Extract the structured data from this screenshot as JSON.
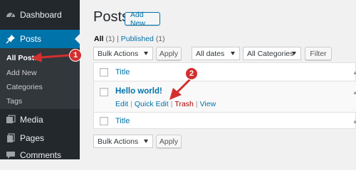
{
  "sidebar": {
    "dashboard": "Dashboard",
    "posts": "Posts",
    "submenu": [
      "All Posts",
      "Add New",
      "Categories",
      "Tags"
    ],
    "media": "Media",
    "pages": "Pages",
    "comments": "Comments"
  },
  "header": {
    "title": "Posts",
    "add_new": "Add New"
  },
  "filters": {
    "all_label": "All",
    "all_count": "(1)",
    "separator": "|",
    "published_label": "Published",
    "published_count": "(1)"
  },
  "toolbar_top": {
    "bulk_actions": "Bulk Actions",
    "apply": "Apply",
    "all_dates": "All dates",
    "all_categories": "All Categories",
    "filter": "Filter"
  },
  "table": {
    "column_title": "Title",
    "rows": [
      {
        "title": "Hello world!",
        "actions": [
          "Edit",
          "Quick Edit",
          "Trash",
          "View"
        ]
      }
    ]
  },
  "toolbar_bottom": {
    "bulk_actions": "Bulk Actions",
    "apply": "Apply"
  },
  "annotations": {
    "badge1": "1",
    "badge2": "2",
    "color": "#d32f2f"
  },
  "colors": {
    "sidebar": "#23282d",
    "accent": "#0073aa",
    "trash": "#a00000"
  }
}
